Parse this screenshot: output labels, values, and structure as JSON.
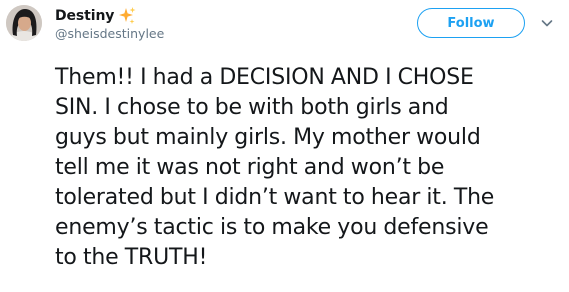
{
  "user": {
    "display_name": "Destiny",
    "handle": "@sheisdestinylee",
    "name_emoji_icon": "sparkles-icon"
  },
  "actions": {
    "follow_label": "Follow",
    "menu_icon": "chevron-down-icon"
  },
  "tweet": {
    "lines": [
      "Them!! I had a DECISION AND I CHOSE",
      "SIN. I chose to be with both girls and",
      "guys but mainly girls. My mother would",
      "tell me it was not right and won’t be",
      "tolerated but I didn’t want to hear it. The",
      "enemy’s tactic is to make you defensive",
      "to the TRUTH!"
    ]
  },
  "colors": {
    "accent": "#1da1f2",
    "text": "#14171a",
    "secondary": "#657786",
    "sparkle": "#ffac33"
  }
}
